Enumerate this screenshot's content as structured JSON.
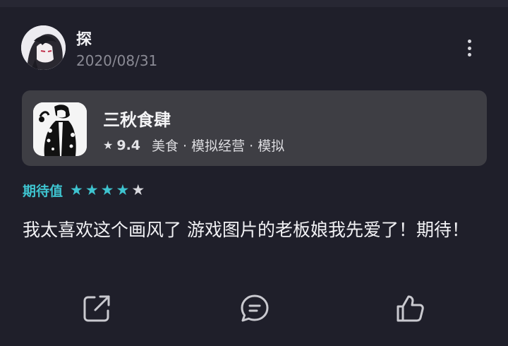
{
  "post": {
    "username": "探",
    "date": "2020/08/31"
  },
  "game": {
    "title": "三秋食肆",
    "score": "9.4",
    "tags": "美食 · 模拟经营 · 模拟"
  },
  "rating": {
    "label": "期待值",
    "stars_filled": 4,
    "stars_total": 5
  },
  "review": {
    "text": "我太喜欢这个画风了 游戏图片的老板娘我先爱了！期待！"
  },
  "icons": {
    "more": "more-vertical-icon",
    "share": "share-icon",
    "comment": "comment-icon",
    "like": "thumbs-up-icon"
  },
  "colors": {
    "background": "#1f1f2a",
    "card": "#3e3e44",
    "accent": "#3ec3cf"
  }
}
